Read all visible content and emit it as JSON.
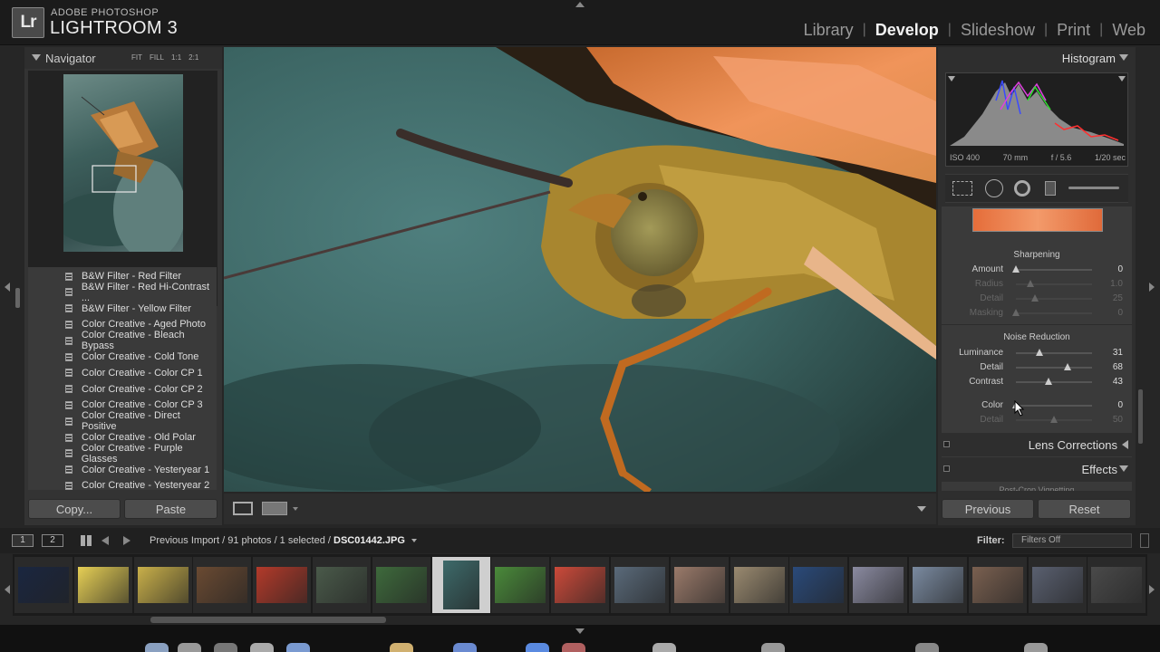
{
  "app": {
    "brand_line1": "ADOBE PHOTOSHOP",
    "brand_line2": "LIGHTROOM 3",
    "logo": "Lr"
  },
  "modules": [
    "Library",
    "Develop",
    "Slideshow",
    "Print",
    "Web"
  ],
  "active_module": "Develop",
  "navigator": {
    "title": "Navigator",
    "options": [
      "FIT",
      "FILL",
      "1:1",
      "2:1"
    ]
  },
  "presets": [
    "B&W Filter - Red Filter",
    "B&W Filter - Red Hi-Contrast ...",
    "B&W Filter - Yellow Filter",
    "Color Creative - Aged Photo",
    "Color Creative - Bleach Bypass",
    "Color Creative - Cold Tone",
    "Color Creative - Color CP 1",
    "Color Creative - Color CP 2",
    "Color Creative - Color CP 3",
    "Color Creative - Direct Positive",
    "Color Creative - Old Polar",
    "Color Creative - Purple Glasses",
    "Color Creative - Yesteryear 1",
    "Color Creative - Yesteryear 2"
  ],
  "left_buttons": {
    "copy": "Copy...",
    "paste": "Paste"
  },
  "histogram": {
    "title": "Histogram",
    "iso": "ISO 400",
    "focal": "70 mm",
    "aperture": "f / 5.6",
    "shutter": "1/20 sec"
  },
  "sharpening": {
    "title": "Sharpening",
    "rows": [
      {
        "label": "Amount",
        "value": "0",
        "level": 0.0,
        "dim": false
      },
      {
        "label": "Radius",
        "value": "1.0",
        "level": 0.19,
        "dim": true
      },
      {
        "label": "Detail",
        "value": "25",
        "level": 0.25,
        "dim": true
      },
      {
        "label": "Masking",
        "value": "0",
        "level": 0.0,
        "dim": true
      }
    ]
  },
  "noise_reduction": {
    "title": "Noise Reduction",
    "rows": [
      {
        "label": "Luminance",
        "value": "31",
        "level": 0.31,
        "dim": false
      },
      {
        "label": "Detail",
        "value": "68",
        "level": 0.68,
        "dim": false
      },
      {
        "label": "Contrast",
        "value": "43",
        "level": 0.43,
        "dim": false
      },
      {
        "label": "Color",
        "value": "0",
        "level": 0.0,
        "dim": false
      },
      {
        "label": "Detail",
        "value": "50",
        "level": 0.5,
        "dim": true
      }
    ]
  },
  "panels": {
    "lens": "Lens Corrections",
    "effects": "Effects",
    "vignette": "Post-Crop Vignetting"
  },
  "right_buttons": {
    "previous": "Previous",
    "reset": "Reset"
  },
  "filmbar": {
    "page1": "1",
    "page2": "2",
    "source": "Previous Import / 91 photos / 1 selected / ",
    "filename": "DSC01442.JPG",
    "filter_label": "Filter:",
    "filter_value": "Filters Off"
  },
  "film_colors": [
    "#1a2640",
    "#e6cf55",
    "#c9b04a",
    "#6a4a32",
    "#b33a2a",
    "#4a5a4a",
    "#3e6a3c",
    "#3d6a6a",
    "#4a8a3a",
    "#cc4a3a",
    "#5a6a7a",
    "#9a7a6a",
    "#9a8a70",
    "#2a4a7a",
    "#8a8aa0",
    "#7a8aa0",
    "#7a6050",
    "#5a6070",
    "#4a4a4a"
  ],
  "selected_thumb": 7
}
